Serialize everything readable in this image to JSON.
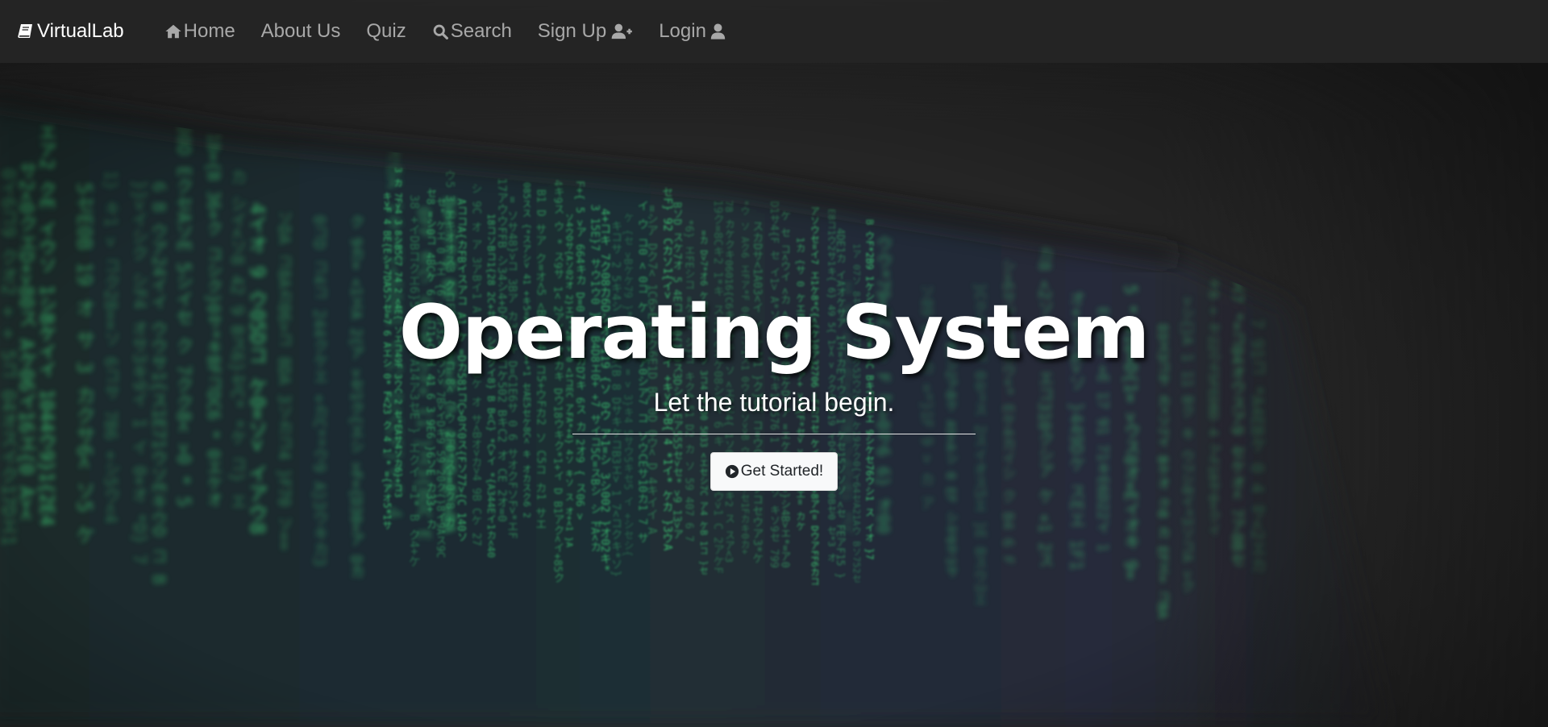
{
  "colors": {
    "navbar_bg": "#252525",
    "nav_link": "#a8a8a8",
    "brand": "#ffffff",
    "hero_text": "#ffffff",
    "code_green": "#3ee07a",
    "button_bg": "#f8f9fa",
    "button_text": "#212529"
  },
  "navbar": {
    "brand": {
      "label": "VirtualLab",
      "icon": "book-icon"
    },
    "links": [
      {
        "label": "Home",
        "icon": "home-icon"
      },
      {
        "label": "About Us"
      },
      {
        "label": "Quiz"
      },
      {
        "label": "Search",
        "icon": "search-icon"
      },
      {
        "label": "Sign Up",
        "icon": "user-plus-icon"
      },
      {
        "label": "Login",
        "icon": "user-icon"
      }
    ]
  },
  "hero": {
    "background": "green-matrix-code-on-monitor",
    "title": "Operating System",
    "subtitle": "Let the tutorial begin.",
    "cta": {
      "label": "Get Started!",
      "icon": "play-circle-icon"
    }
  }
}
